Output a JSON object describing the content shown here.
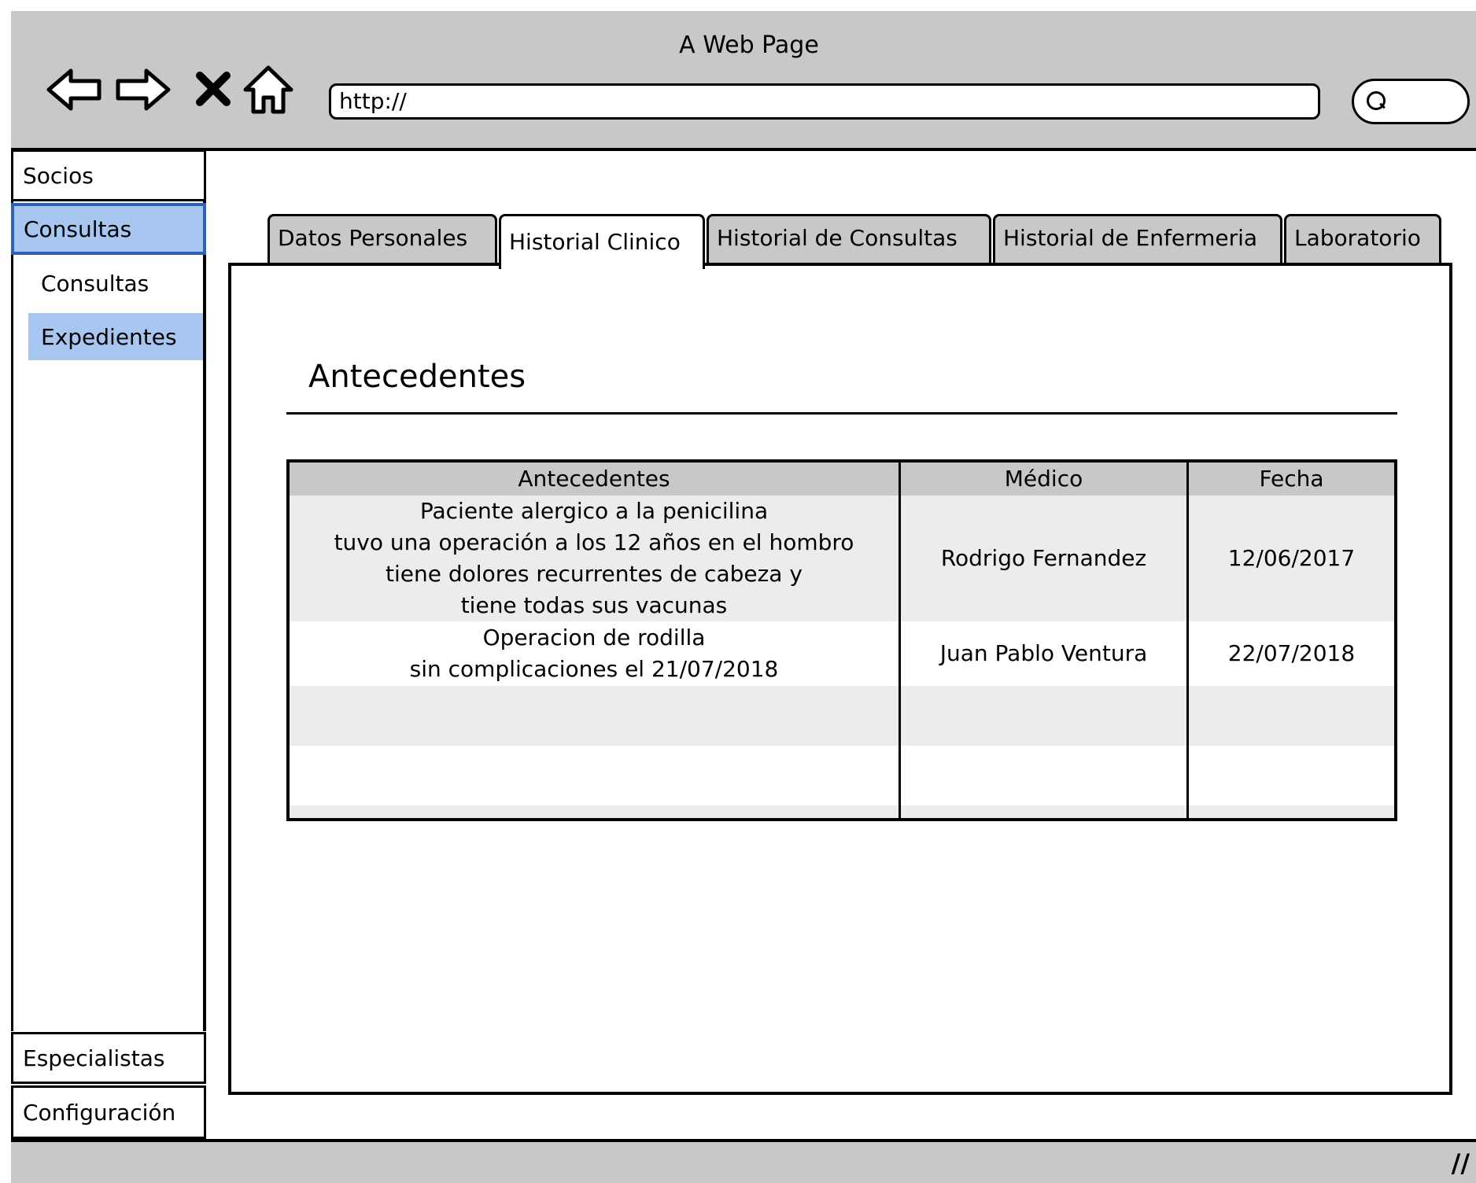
{
  "window": {
    "title": "A Web Page"
  },
  "toolbar": {
    "back_icon": "back-arrow-icon",
    "forward_icon": "forward-arrow-icon",
    "stop_icon": "close-icon",
    "home_icon": "home-icon",
    "url": "http://",
    "search_icon": "search-icon"
  },
  "sidebar": {
    "items": [
      {
        "label": "Socios"
      },
      {
        "label": "Consultas"
      }
    ],
    "sub_items": [
      {
        "label": "Consultas"
      },
      {
        "label": "Expedientes"
      }
    ],
    "bottom_items": [
      {
        "label": "Especialistas"
      },
      {
        "label": "Configuración"
      }
    ]
  },
  "tabs": [
    {
      "label": "Datos Personales"
    },
    {
      "label": "Historial Clinico"
    },
    {
      "label": "Historial de Consultas"
    },
    {
      "label": "Historial de Enfermeria"
    },
    {
      "label": "Laboratorio"
    }
  ],
  "section": {
    "title": "Antecedentes"
  },
  "table": {
    "headers": [
      "Antecedentes",
      "Médico",
      "Fecha"
    ],
    "rows": [
      {
        "antecedentes": "Paciente alergico a la penicilina\ntuvo una operación a los 12 años en el hombro\ntiene dolores recurrentes de cabeza y\ntiene todas sus vacunas",
        "medico": "Rodrigo Fernandez",
        "fecha": "12/06/2017"
      },
      {
        "antecedentes": "Operacion de rodilla\nsin complicaciones el 21/07/2018",
        "medico": "Juan Pablo Ventura",
        "fecha": "22/07/2018"
      },
      {
        "antecedentes": "",
        "medico": "",
        "fecha": ""
      },
      {
        "antecedentes": "",
        "medico": "",
        "fecha": ""
      }
    ]
  },
  "colors": {
    "chrome": "#c8c8c8",
    "selected": "#a8c7f0",
    "selected_border": "#2f62b5",
    "row_alt": "#ececec"
  }
}
